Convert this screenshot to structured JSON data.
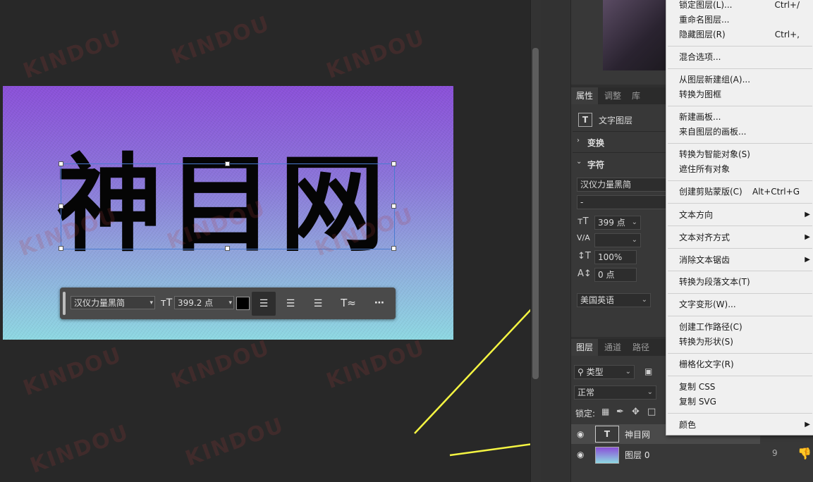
{
  "canvas": {
    "headline": "神目网",
    "toolbar": {
      "font_family": "汉仪力量黑简",
      "font_size": "399.2 点",
      "color_swatch": "#000000"
    }
  },
  "watermark_text": "KINDOU",
  "properties": {
    "tabs": [
      "属性",
      "调整",
      "库"
    ],
    "layer_kind": "文字图层",
    "section_transform": "变换",
    "section_character": "字符",
    "font_family": "汉仪力量黑简",
    "font_style": "-",
    "font_size": "399 点",
    "kerning_label": "V/A",
    "vertical_scale": "100%",
    "baseline_shift": "0 点",
    "language": "美国英语"
  },
  "layers": {
    "tabs": [
      "图层",
      "通道",
      "路径"
    ],
    "filter_kind": "类型",
    "blend_mode": "正常",
    "lock_label": "锁定:",
    "rows": [
      {
        "name": "神目网"
      },
      {
        "name": "图层 0"
      }
    ],
    "partial_number": "9"
  },
  "context_menu": {
    "items": [
      {
        "label": "锁定图层(L)...",
        "shortcut": "Ctrl+/"
      },
      {
        "label": "重命名图层..."
      },
      {
        "label": "隐藏图层(R)",
        "shortcut": "Ctrl+,"
      },
      {
        "label": "混合选项..."
      },
      {
        "label": "从图层新建组(A)..."
      },
      {
        "label": "转换为图框"
      },
      {
        "label": "新建画板..."
      },
      {
        "label": "来自图层的画板..."
      },
      {
        "label": "转换为智能对象(S)"
      },
      {
        "label": "遮住所有对象"
      },
      {
        "label": "创建剪贴蒙版(C)",
        "shortcut": "Alt+Ctrl+G"
      },
      {
        "label": "文本方向",
        "submenu": true
      },
      {
        "label": "文本对齐方式",
        "submenu": true
      },
      {
        "label": "消除文本锯齿",
        "submenu": true
      },
      {
        "label": "转换为段落文本(T)"
      },
      {
        "label": "文字变形(W)..."
      },
      {
        "label": "创建工作路径(C)"
      },
      {
        "label": "转换为形状(S)"
      },
      {
        "label": "栅格化文字(R)"
      },
      {
        "label": "复制 CSS"
      },
      {
        "label": "复制 SVG"
      },
      {
        "label": "颜色",
        "submenu": true
      }
    ]
  },
  "colors": {
    "arrow": "#f5f542",
    "menu_bg": "#f0f0f0",
    "panel_bg": "#383838"
  }
}
